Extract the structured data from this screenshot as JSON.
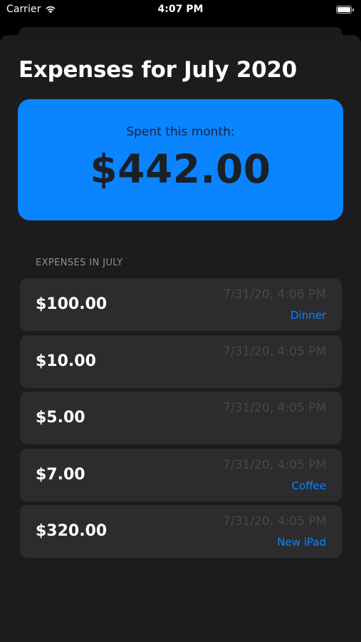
{
  "status_bar": {
    "carrier": "Carrier",
    "time": "4:07 PM"
  },
  "page": {
    "title": "Expenses for July 2020"
  },
  "summary": {
    "label": "Spent this month:",
    "total": "$442.00"
  },
  "list": {
    "header": "EXPENSES IN JULY",
    "items": [
      {
        "amount": "$100.00",
        "date": "7/31/20, 4:06 PM",
        "note": "Dinner"
      },
      {
        "amount": "$10.00",
        "date": "7/31/20, 4:05 PM",
        "note": ""
      },
      {
        "amount": "$5.00",
        "date": "7/31/20, 4:05 PM",
        "note": ""
      },
      {
        "amount": "$7.00",
        "date": "7/31/20, 4:05 PM",
        "note": "Coffee"
      },
      {
        "amount": "$320.00",
        "date": "7/31/20, 4:05 PM",
        "note": "New iPad"
      }
    ]
  },
  "colors": {
    "accent": "#0a84ff",
    "background": "#1c1c1e",
    "row_background": "#2c2c2e",
    "date_text": "#48484a",
    "section_header_text": "#8e8e93"
  },
  "icons": {
    "signal": "wifi-icon",
    "battery": "battery-icon"
  }
}
